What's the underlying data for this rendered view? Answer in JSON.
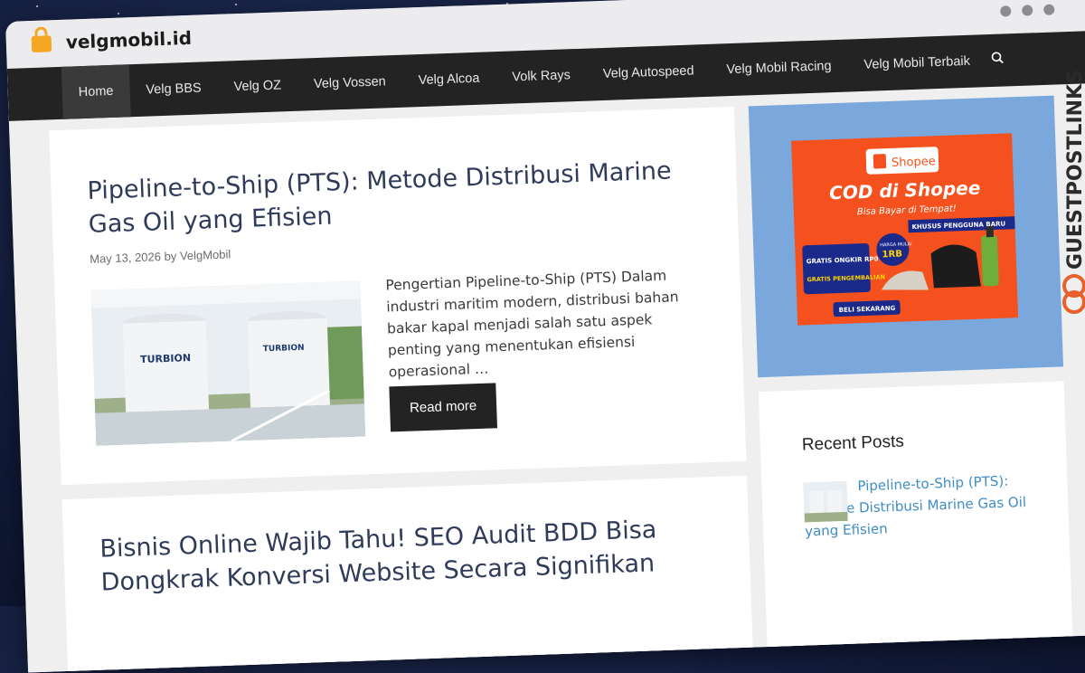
{
  "browser": {
    "url": "velgmobil.id"
  },
  "nav": {
    "items": [
      {
        "label": "Home",
        "active": true
      },
      {
        "label": "Velg BBS"
      },
      {
        "label": "Velg OZ"
      },
      {
        "label": "Velg Vossen"
      },
      {
        "label": "Velg Alcoa"
      },
      {
        "label": "Volk Rays"
      },
      {
        "label": "Velg Autospeed"
      },
      {
        "label": "Velg Mobil Racing"
      },
      {
        "label": "Velg Mobil Terbaik"
      }
    ],
    "search_icon": "search-icon"
  },
  "posts": [
    {
      "title": "Pipeline-to-Ship (PTS): Metode Distribusi Marine Gas Oil yang Efisien",
      "date": "May 13, 2026",
      "by": "by",
      "author": "VelgMobil",
      "excerpt": "Pengertian Pipeline-to-Ship (PTS) Dalam industri maritim modern, distribusi bahan bakar kapal menjadi salah satu aspek penting yang menentukan efisiensi operasional …",
      "read_more": "Read more",
      "image_text": "TURBION"
    },
    {
      "title": "Bisnis Online Wajib Tahu! SEO Audit BDD Bisa Dongkrak Konversi Website Secara Signifikan"
    }
  ],
  "sidebar": {
    "ad": {
      "brand": "Shopee",
      "headline": "COD di Shopee",
      "sub": "Bisa Bayar di Tempat!",
      "badge": "KHUSUS PENGGUNA BARU",
      "free_shipping": "GRATIS ONGKIR RP0",
      "free_return": "GRATIS PENGEMBALIAN",
      "price_from": "HARGA MULAI",
      "price": "1RB",
      "cta": "BELI SEKARANG"
    },
    "recent_title": "Recent Posts",
    "recent_items": [
      {
        "title": "Pipeline-to-Ship (PTS): Metode Distribusi Marine Gas Oil yang Efisien"
      }
    ]
  },
  "watermark": "GUESTPOSTLINKS",
  "colors": {
    "nav_bg": "#232323",
    "title": "#2f3b59",
    "link": "#3f8dc6",
    "ad_bg": "#7aa8dd",
    "shopee": "#f4511e",
    "lock": "#f5a623"
  }
}
